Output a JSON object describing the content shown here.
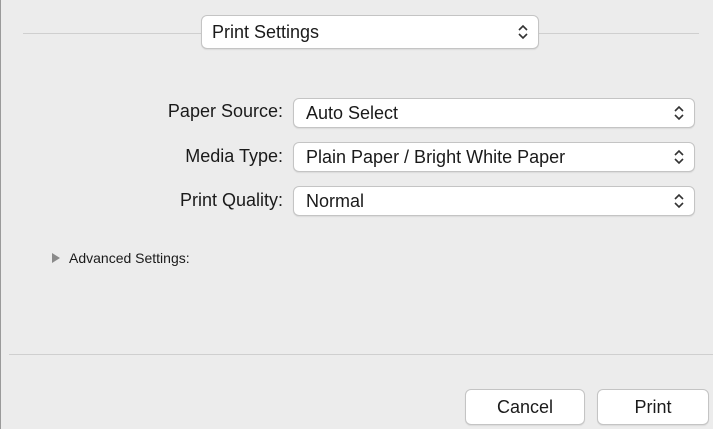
{
  "header": {
    "panel_selector": "Print Settings"
  },
  "settings": {
    "paper_source": {
      "label": "Paper Source:",
      "value": "Auto Select"
    },
    "media_type": {
      "label": "Media Type:",
      "value": "Plain Paper / Bright White Paper"
    },
    "print_quality": {
      "label": "Print Quality:",
      "value": "Normal"
    }
  },
  "advanced": {
    "label": "Advanced Settings:"
  },
  "footer": {
    "cancel_label": "Cancel",
    "print_label": "Print"
  },
  "icons": {
    "updown": "chevron-updown-icon",
    "disclosure": "disclosure-triangle-icon"
  }
}
